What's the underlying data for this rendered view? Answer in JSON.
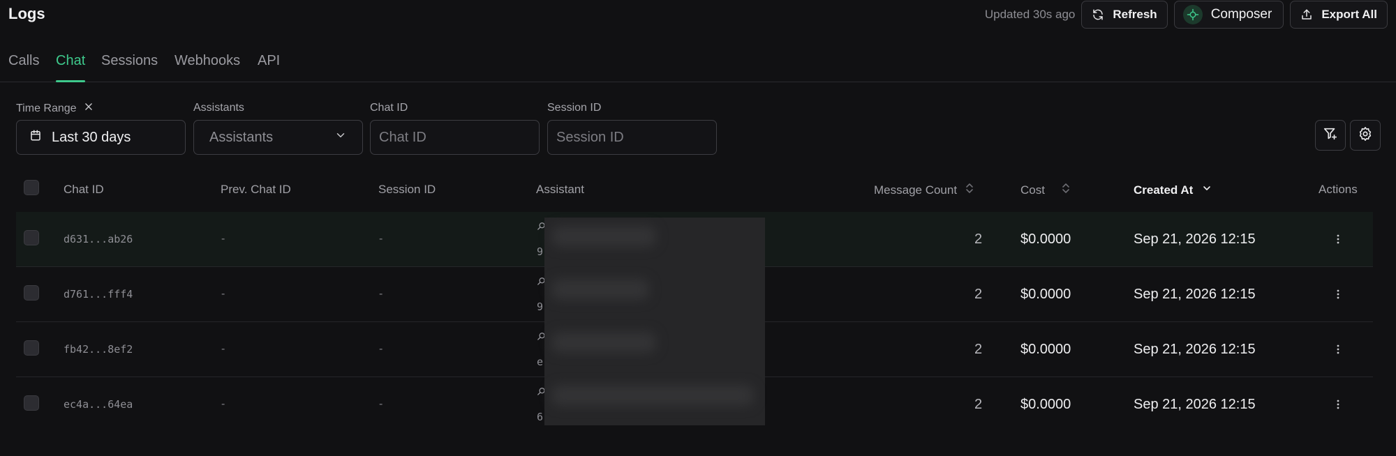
{
  "header": {
    "title": "Logs",
    "updated": "Updated 30s ago",
    "refresh_label": "Refresh",
    "composer_label": "Composer",
    "export_label": "Export All"
  },
  "tabs": [
    {
      "label": "Calls",
      "active": false
    },
    {
      "label": "Chat",
      "active": true
    },
    {
      "label": "Sessions",
      "active": false
    },
    {
      "label": "Webhooks",
      "active": false
    },
    {
      "label": "API",
      "active": false
    }
  ],
  "filters": {
    "time_range": {
      "label": "Time Range",
      "value": "Last 30 days"
    },
    "assistants": {
      "label": "Assistants",
      "placeholder": "Assistants"
    },
    "chat_id": {
      "label": "Chat ID",
      "placeholder": "Chat ID"
    },
    "session_id": {
      "label": "Session ID",
      "placeholder": "Session ID"
    }
  },
  "table": {
    "columns": {
      "chat_id": "Chat ID",
      "prev_chat_id": "Prev. Chat ID",
      "session_id": "Session ID",
      "assistant": "Assistant",
      "message_count": "Message Count",
      "cost": "Cost",
      "created_at": "Created At",
      "actions": "Actions"
    },
    "rows": [
      {
        "chat_id": "d631...ab26",
        "prev_chat_id": "-",
        "session_id": "-",
        "assistant_id": "9",
        "message_count": "2",
        "cost": "$0.0000",
        "created_at": "Sep 21, 2026 12:15"
      },
      {
        "chat_id": "d761...fff4",
        "prev_chat_id": "-",
        "session_id": "-",
        "assistant_id": "9",
        "message_count": "2",
        "cost": "$0.0000",
        "created_at": "Sep 21, 2026 12:15"
      },
      {
        "chat_id": "fb42...8ef2",
        "prev_chat_id": "-",
        "session_id": "-",
        "assistant_id": "e",
        "message_count": "2",
        "cost": "$0.0000",
        "created_at": "Sep 21, 2026 12:15"
      },
      {
        "chat_id": "ec4a...64ea",
        "prev_chat_id": "-",
        "session_id": "-",
        "assistant_id": "6",
        "message_count": "2",
        "cost": "$0.0000",
        "created_at": "Sep 21, 2026 12:15"
      }
    ]
  },
  "colors": {
    "accent": "#3ec98c",
    "background": "#111113",
    "border": "#3d3d42"
  }
}
